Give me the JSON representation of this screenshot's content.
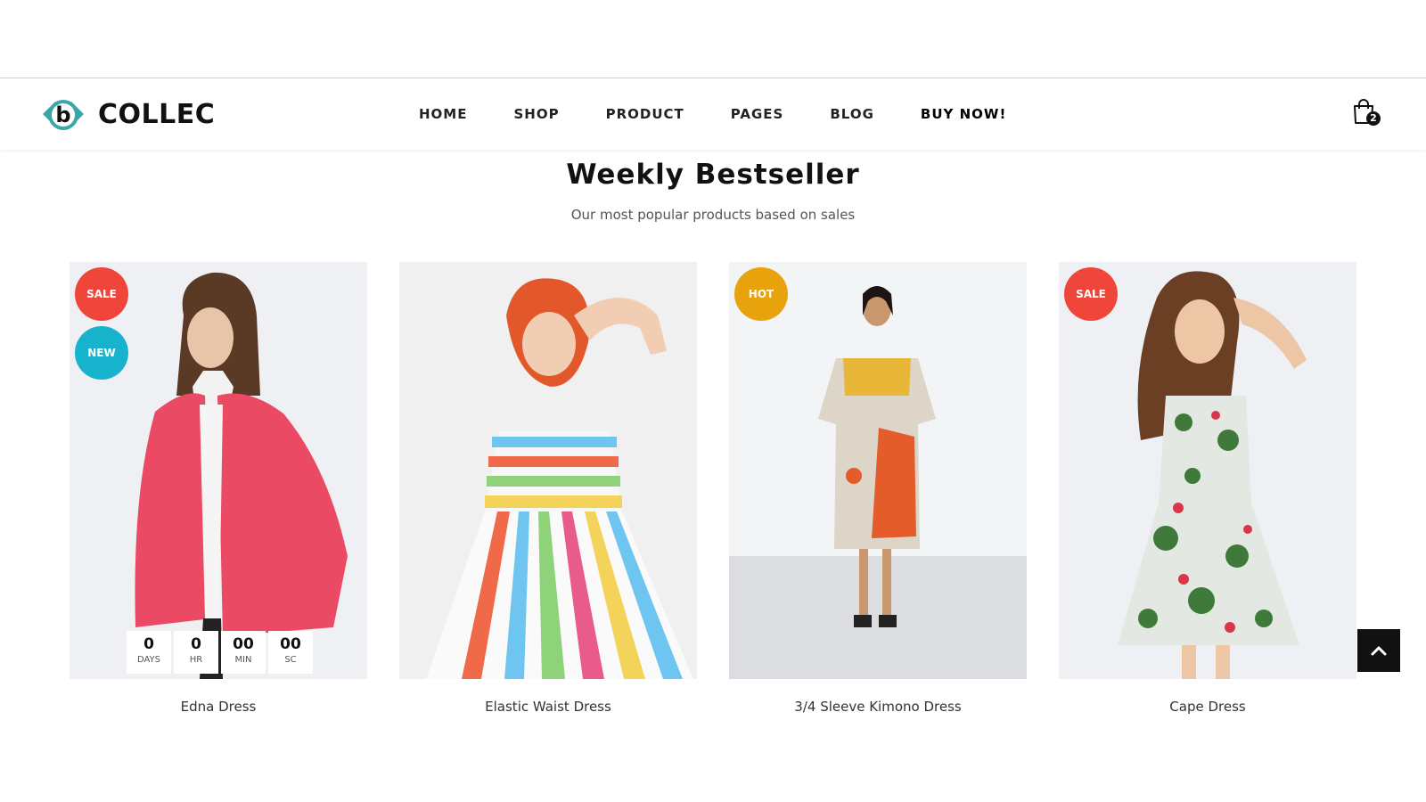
{
  "brand": {
    "name": "COLLEC",
    "mark_letter": "b",
    "accent_color": "#3aa6a8"
  },
  "nav": {
    "items": [
      {
        "label": "HOME"
      },
      {
        "label": "SHOP"
      },
      {
        "label": "PRODUCT"
      },
      {
        "label": "PAGES"
      },
      {
        "label": "BLOG"
      },
      {
        "label": "BUY NOW!"
      }
    ],
    "cart": {
      "icon": "shopping-bag-icon",
      "count": "2"
    }
  },
  "section": {
    "title": "Weekly Bestseller",
    "subtitle": "Our most popular products based on sales"
  },
  "products": [
    {
      "name": "Edna Dress",
      "badges": [
        {
          "label": "SALE",
          "color": "#f0453a"
        },
        {
          "label": "NEW",
          "color": "#17b3cc"
        }
      ],
      "countdown": [
        {
          "value": "0",
          "label": "DAYS"
        },
        {
          "value": "0",
          "label": "HR"
        },
        {
          "value": "00",
          "label": "MIN"
        },
        {
          "value": "00",
          "label": "SC"
        }
      ]
    },
    {
      "name": "Elastic Waist Dress",
      "badges": []
    },
    {
      "name": "3/4 Sleeve Kimono Dress",
      "badges": [
        {
          "label": "HOT",
          "color": "#e8a20c"
        }
      ]
    },
    {
      "name": "Cape Dress",
      "badges": [
        {
          "label": "SALE",
          "color": "#f0453a"
        }
      ]
    }
  ],
  "back_to_top": {
    "icon": "chevron-up-icon"
  }
}
